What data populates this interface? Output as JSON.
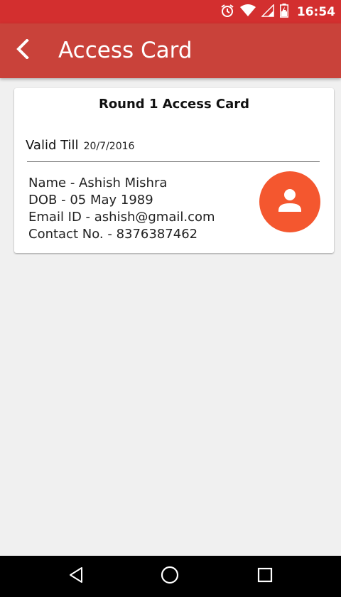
{
  "status_bar": {
    "time": "16:54",
    "icons": [
      "alarm-icon",
      "wifi-icon",
      "signal-icon",
      "battery-charging-icon"
    ]
  },
  "app_bar": {
    "title": "Access Card",
    "back_icon": "chevron-left-icon"
  },
  "card": {
    "title": "Round 1 Access Card",
    "valid_label": "Valid Till",
    "valid_date": "20/7/2016",
    "details": {
      "name": "Name - Ashish Mishra",
      "dob": "DOB - 05 May 1989",
      "email": "Email ID - ashish@gmail.com",
      "contact": "Contact No. - 8376387462"
    },
    "avatar_icon": "person-icon",
    "avatar_color": "#f4572f"
  },
  "nav_bar": {
    "buttons": [
      "back-triangle-icon",
      "home-circle-icon",
      "recents-square-icon"
    ]
  },
  "colors": {
    "status_bar": "#d32f2f",
    "app_bar": "#c9423a",
    "background": "#f0f0f0"
  }
}
